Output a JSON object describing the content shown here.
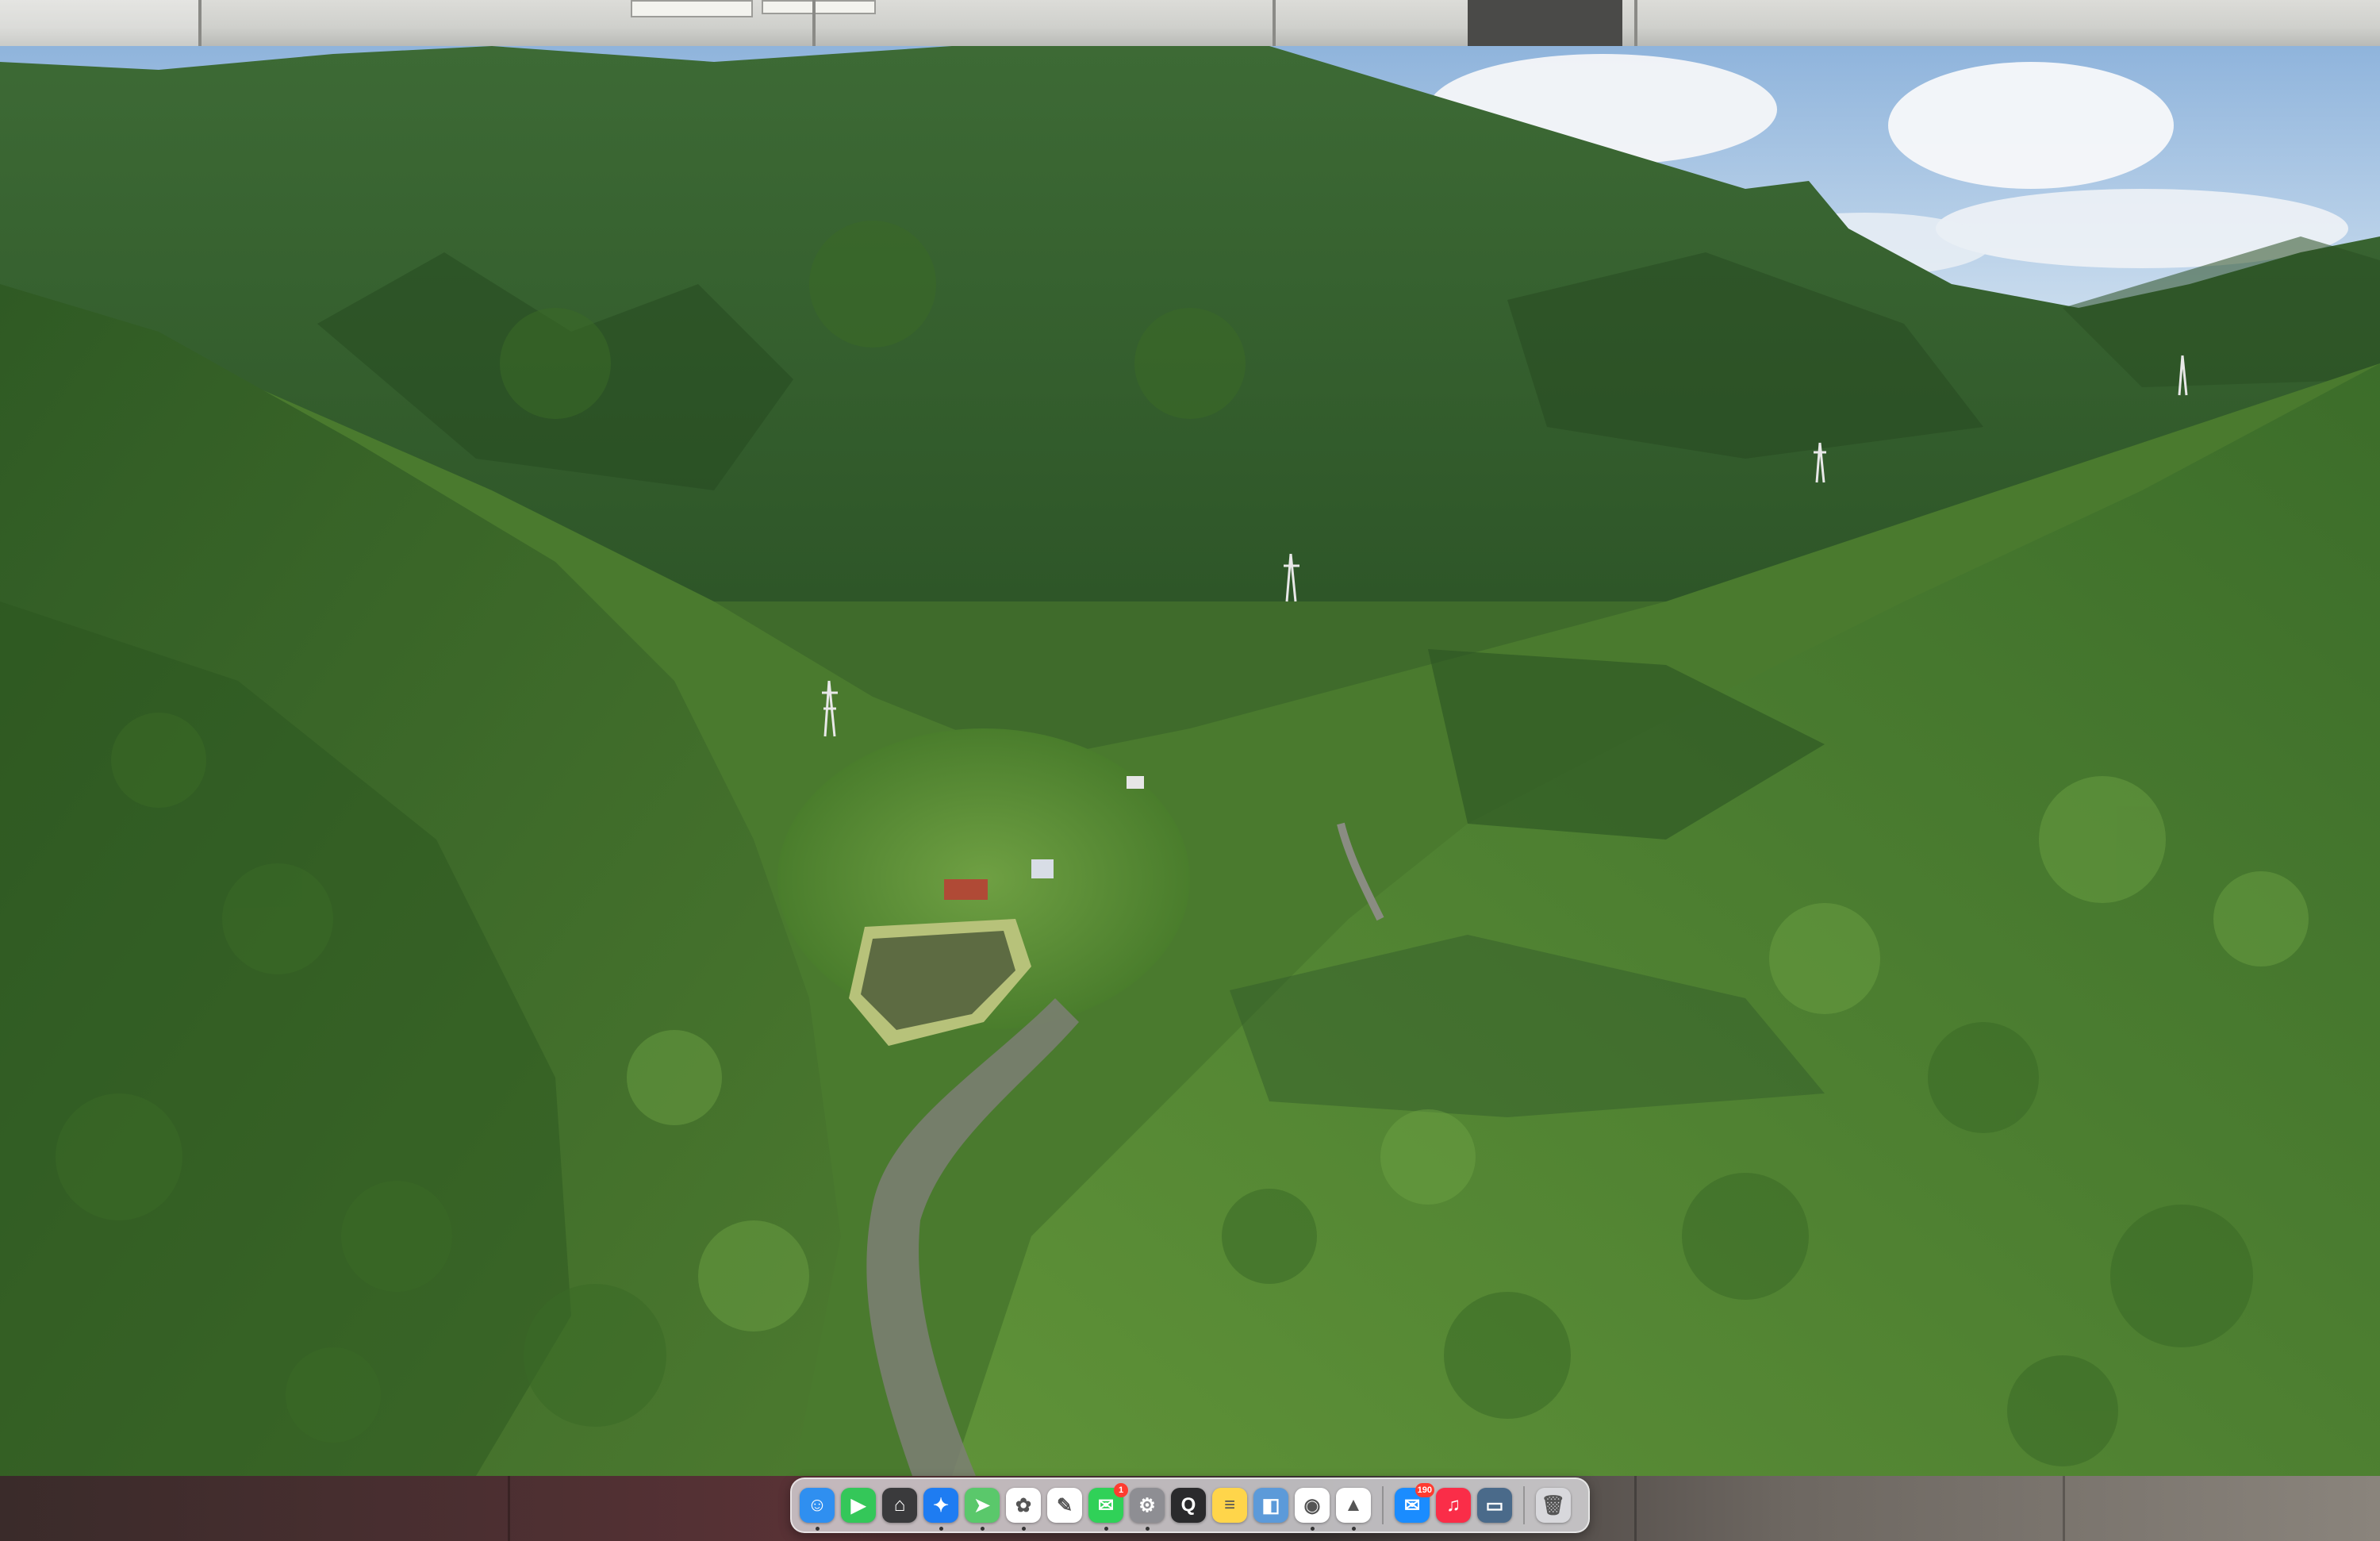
{
  "screen": {
    "wallpaper": "aerial-mountain-valley-forest",
    "sky_color": "#b9d3ea",
    "forest_color": "#3f6b2b"
  },
  "dock": {
    "apps": [
      {
        "name": "Finder",
        "icon": "finder-icon",
        "color": "#2f8ff0",
        "glyph": "☺",
        "running": true
      },
      {
        "name": "FaceTime",
        "icon": "facetime-icon",
        "color": "#34c759",
        "glyph": "▶",
        "running": false
      },
      {
        "name": "Launchpad",
        "icon": "launchpad-icon",
        "color": "#3a3a3c",
        "glyph": "⌂",
        "running": false
      },
      {
        "name": "Safari",
        "icon": "safari-icon",
        "color": "#1e7cf2",
        "glyph": "✦",
        "running": true
      },
      {
        "name": "Maps",
        "icon": "maps-icon",
        "color": "#5ac86b",
        "glyph": "➤",
        "running": true
      },
      {
        "name": "Photos",
        "icon": "photos-icon",
        "color": "#ffffff",
        "glyph": "✿",
        "running": true
      },
      {
        "name": "Notes Pen",
        "icon": "freeform-icon",
        "color": "#ffffff",
        "glyph": "✎",
        "running": false
      },
      {
        "name": "Messages",
        "icon": "messages-icon",
        "color": "#30d158",
        "glyph": "✉",
        "running": true,
        "badge": "1"
      },
      {
        "name": "System Settings",
        "icon": "settings-icon",
        "color": "#8e8e93",
        "glyph": "⚙",
        "running": true
      },
      {
        "name": "QuickTime",
        "icon": "quicktime-icon",
        "color": "#2a2a2c",
        "glyph": "Q",
        "running": false
      },
      {
        "name": "Notes",
        "icon": "notes-icon",
        "color": "#ffd54a",
        "glyph": "≡",
        "running": false
      },
      {
        "name": "Preview",
        "icon": "preview-icon",
        "color": "#5c9ad9",
        "glyph": "◧",
        "running": false
      },
      {
        "name": "Chrome",
        "icon": "chrome-icon",
        "color": "#ffffff",
        "glyph": "◉",
        "running": true
      },
      {
        "name": "Drive",
        "icon": "drive-icon",
        "color": "#ffffff",
        "glyph": "▲",
        "running": true
      }
    ],
    "right_apps": [
      {
        "name": "Mail",
        "icon": "mail-icon",
        "color": "#1a8cff",
        "glyph": "✉",
        "running": false,
        "badge": "190"
      },
      {
        "name": "Music",
        "icon": "music-icon",
        "color": "#fa2d48",
        "glyph": "♫",
        "running": false
      },
      {
        "name": "Screen",
        "icon": "screen-sharing-icon",
        "color": "#4a6a8a",
        "glyph": "▭",
        "running": false
      }
    ],
    "trash": {
      "name": "Trash",
      "icon": "trash-icon",
      "color": "#d8d8dc",
      "glyph": "🗑"
    }
  }
}
